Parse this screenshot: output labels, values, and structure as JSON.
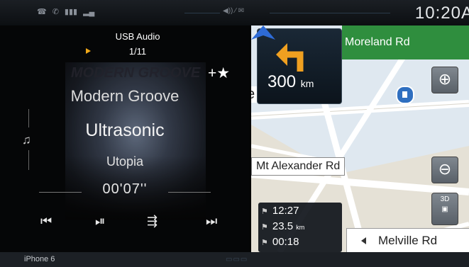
{
  "status": {
    "icons": [
      "phone-icon",
      "voicemail-icon",
      "battery-icon",
      "signal-icon"
    ],
    "clock": "10:20A"
  },
  "media": {
    "source": "USB Audio",
    "track_number": "1/11",
    "favorite": "+★",
    "album_art_text": "MODERN GROOVE",
    "song": "Modern Groove",
    "artist": "Ultrasonic",
    "album": "Utopia",
    "elapsed": "00'07''",
    "controls": [
      "previous-icon",
      "play-pause-icon",
      "shuffle-icon",
      "next-icon"
    ],
    "control_glyphs": [
      "⏮",
      "⏯",
      "⇶",
      "⏭"
    ]
  },
  "device": "iPhone 6",
  "map": {
    "next_street": "Moreland Rd",
    "distance_value": "300",
    "distance_unit": "km",
    "side_road": "e",
    "street_label": "Mt Alexander Rd",
    "zoom_in": "⊕",
    "zoom_out": "⊖",
    "view_3d": "3D",
    "current_street": "Melville Rd",
    "trip": {
      "arrival": "12:27",
      "distance_value": "23.5",
      "distance_unit": "km",
      "duration": "00:18"
    }
  },
  "colors": {
    "accent_green": "#2f8e3e",
    "maneuver_orange": "#f0a020",
    "play_indicator": "#f0a818"
  }
}
